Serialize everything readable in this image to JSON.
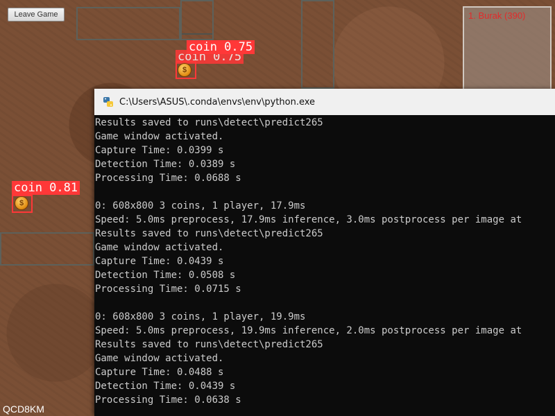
{
  "game": {
    "leave_button_label": "Leave Game",
    "leaderboard": {
      "entries": [
        "1. Burak (390)"
      ]
    },
    "watermark": "QCD8KM",
    "detections": [
      {
        "label": "coin 0.75",
        "ghost_label": "coin 0.75",
        "coin_symbol": "$"
      },
      {
        "label": "coin 0.81",
        "coin_symbol": "$"
      }
    ]
  },
  "console": {
    "title": "C:\\Users\\ASUS\\.conda\\envs\\env\\python.exe",
    "lines": [
      "Results saved to runs\\detect\\predict265",
      "Game window activated.",
      "Capture Time: 0.0399 s",
      "Detection Time: 0.0389 s",
      "Processing Time: 0.0688 s",
      "",
      "0: 608x800 3 coins, 1 player, 17.9ms",
      "Speed: 5.0ms preprocess, 17.9ms inference, 3.0ms postprocess per image at",
      "Results saved to runs\\detect\\predict265",
      "Game window activated.",
      "Capture Time: 0.0439 s",
      "Detection Time: 0.0508 s",
      "Processing Time: 0.0715 s",
      "",
      "0: 608x800 3 coins, 1 player, 19.9ms",
      "Speed: 5.0ms preprocess, 19.9ms inference, 2.0ms postprocess per image at",
      "Results saved to runs\\detect\\predict265",
      "Game window activated.",
      "Capture Time: 0.0488 s",
      "Detection Time: 0.0439 s",
      "Processing Time: 0.0638 s"
    ]
  }
}
